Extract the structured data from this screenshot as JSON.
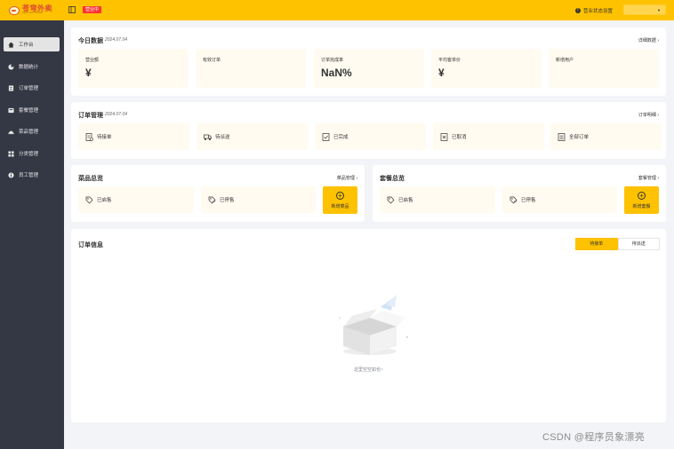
{
  "app": {
    "brand": "苍穹外卖",
    "brand_sub": "TAKE OUT FOOD",
    "status_badge": "营业中",
    "shop_status_label": "营业状态设置",
    "accent": "#ffc200",
    "sidebar_bg": "#343744"
  },
  "sidebar": {
    "items": [
      {
        "label": "工作台",
        "icon": "home-icon"
      },
      {
        "label": "数据统计",
        "icon": "chart-icon"
      },
      {
        "label": "订单管理",
        "icon": "order-icon"
      },
      {
        "label": "套餐管理",
        "icon": "combo-icon"
      },
      {
        "label": "菜品管理",
        "icon": "dish-icon"
      },
      {
        "label": "分类管理",
        "icon": "category-icon"
      },
      {
        "label": "员工管理",
        "icon": "employee-icon"
      }
    ]
  },
  "today": {
    "title": "今日数据",
    "date": "2024.07.04",
    "link": "详细数据",
    "stats": [
      {
        "label": "营业额",
        "value": "¥"
      },
      {
        "label": "有效订单",
        "value": ""
      },
      {
        "label": "订单完成率",
        "value": "NaN%"
      },
      {
        "label": "平均客单价",
        "value": "¥"
      },
      {
        "label": "新增用户",
        "value": ""
      }
    ]
  },
  "orders": {
    "title": "订单管理",
    "date": "2024.07.04",
    "link": "订单明细",
    "items": [
      {
        "label": "待接单"
      },
      {
        "label": "待派送"
      },
      {
        "label": "已完成"
      },
      {
        "label": "已取消"
      },
      {
        "label": "全部订单"
      }
    ]
  },
  "dishes": {
    "title": "菜品总览",
    "link": "菜品管理",
    "on_sale": "已启售",
    "off_sale": "已停售",
    "add": "新增菜品"
  },
  "combos": {
    "title": "套餐总览",
    "link": "套餐管理",
    "on_sale": "已启售",
    "off_sale": "已停售",
    "add": "新增套餐"
  },
  "order_info": {
    "title": "订单信息",
    "tabs": [
      "待接单",
      "待派送"
    ],
    "empty_text": "这里空空如也~"
  },
  "watermark": "CSDN @程序员象漂亮"
}
